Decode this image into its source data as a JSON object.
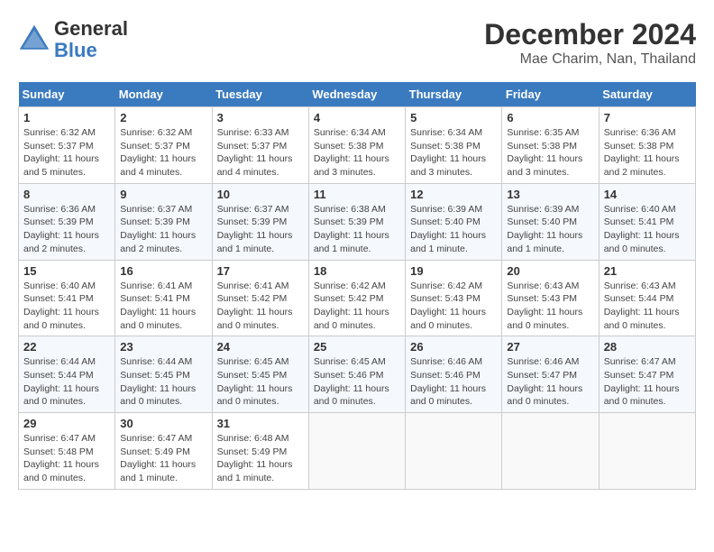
{
  "logo": {
    "general": "General",
    "blue": "Blue"
  },
  "title": "December 2024",
  "location": "Mae Charim, Nan, Thailand",
  "days_of_week": [
    "Sunday",
    "Monday",
    "Tuesday",
    "Wednesday",
    "Thursday",
    "Friday",
    "Saturday"
  ],
  "weeks": [
    [
      {
        "day": "1",
        "sunrise": "6:32 AM",
        "sunset": "5:37 PM",
        "daylight": "11 hours and 5 minutes."
      },
      {
        "day": "2",
        "sunrise": "6:32 AM",
        "sunset": "5:37 PM",
        "daylight": "11 hours and 4 minutes."
      },
      {
        "day": "3",
        "sunrise": "6:33 AM",
        "sunset": "5:37 PM",
        "daylight": "11 hours and 4 minutes."
      },
      {
        "day": "4",
        "sunrise": "6:34 AM",
        "sunset": "5:38 PM",
        "daylight": "11 hours and 3 minutes."
      },
      {
        "day": "5",
        "sunrise": "6:34 AM",
        "sunset": "5:38 PM",
        "daylight": "11 hours and 3 minutes."
      },
      {
        "day": "6",
        "sunrise": "6:35 AM",
        "sunset": "5:38 PM",
        "daylight": "11 hours and 3 minutes."
      },
      {
        "day": "7",
        "sunrise": "6:36 AM",
        "sunset": "5:38 PM",
        "daylight": "11 hours and 2 minutes."
      }
    ],
    [
      {
        "day": "8",
        "sunrise": "6:36 AM",
        "sunset": "5:39 PM",
        "daylight": "11 hours and 2 minutes."
      },
      {
        "day": "9",
        "sunrise": "6:37 AM",
        "sunset": "5:39 PM",
        "daylight": "11 hours and 2 minutes."
      },
      {
        "day": "10",
        "sunrise": "6:37 AM",
        "sunset": "5:39 PM",
        "daylight": "11 hours and 1 minute."
      },
      {
        "day": "11",
        "sunrise": "6:38 AM",
        "sunset": "5:39 PM",
        "daylight": "11 hours and 1 minute."
      },
      {
        "day": "12",
        "sunrise": "6:39 AM",
        "sunset": "5:40 PM",
        "daylight": "11 hours and 1 minute."
      },
      {
        "day": "13",
        "sunrise": "6:39 AM",
        "sunset": "5:40 PM",
        "daylight": "11 hours and 1 minute."
      },
      {
        "day": "14",
        "sunrise": "6:40 AM",
        "sunset": "5:41 PM",
        "daylight": "11 hours and 0 minutes."
      }
    ],
    [
      {
        "day": "15",
        "sunrise": "6:40 AM",
        "sunset": "5:41 PM",
        "daylight": "11 hours and 0 minutes."
      },
      {
        "day": "16",
        "sunrise": "6:41 AM",
        "sunset": "5:41 PM",
        "daylight": "11 hours and 0 minutes."
      },
      {
        "day": "17",
        "sunrise": "6:41 AM",
        "sunset": "5:42 PM",
        "daylight": "11 hours and 0 minutes."
      },
      {
        "day": "18",
        "sunrise": "6:42 AM",
        "sunset": "5:42 PM",
        "daylight": "11 hours and 0 minutes."
      },
      {
        "day": "19",
        "sunrise": "6:42 AM",
        "sunset": "5:43 PM",
        "daylight": "11 hours and 0 minutes."
      },
      {
        "day": "20",
        "sunrise": "6:43 AM",
        "sunset": "5:43 PM",
        "daylight": "11 hours and 0 minutes."
      },
      {
        "day": "21",
        "sunrise": "6:43 AM",
        "sunset": "5:44 PM",
        "daylight": "11 hours and 0 minutes."
      }
    ],
    [
      {
        "day": "22",
        "sunrise": "6:44 AM",
        "sunset": "5:44 PM",
        "daylight": "11 hours and 0 minutes."
      },
      {
        "day": "23",
        "sunrise": "6:44 AM",
        "sunset": "5:45 PM",
        "daylight": "11 hours and 0 minutes."
      },
      {
        "day": "24",
        "sunrise": "6:45 AM",
        "sunset": "5:45 PM",
        "daylight": "11 hours and 0 minutes."
      },
      {
        "day": "25",
        "sunrise": "6:45 AM",
        "sunset": "5:46 PM",
        "daylight": "11 hours and 0 minutes."
      },
      {
        "day": "26",
        "sunrise": "6:46 AM",
        "sunset": "5:46 PM",
        "daylight": "11 hours and 0 minutes."
      },
      {
        "day": "27",
        "sunrise": "6:46 AM",
        "sunset": "5:47 PM",
        "daylight": "11 hours and 0 minutes."
      },
      {
        "day": "28",
        "sunrise": "6:47 AM",
        "sunset": "5:47 PM",
        "daylight": "11 hours and 0 minutes."
      }
    ],
    [
      {
        "day": "29",
        "sunrise": "6:47 AM",
        "sunset": "5:48 PM",
        "daylight": "11 hours and 0 minutes."
      },
      {
        "day": "30",
        "sunrise": "6:47 AM",
        "sunset": "5:49 PM",
        "daylight": "11 hours and 1 minute."
      },
      {
        "day": "31",
        "sunrise": "6:48 AM",
        "sunset": "5:49 PM",
        "daylight": "11 hours and 1 minute."
      },
      null,
      null,
      null,
      null
    ]
  ],
  "labels": {
    "sunrise": "Sunrise:",
    "sunset": "Sunset:",
    "daylight": "Daylight:"
  }
}
